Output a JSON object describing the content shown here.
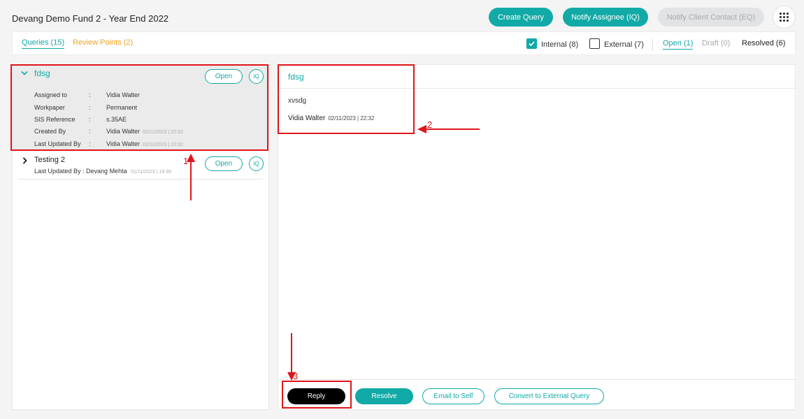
{
  "header": {
    "title": "Devang Demo Fund 2 - Year End 2022",
    "create_query": "Create Query",
    "notify_assignee": "Notify Assignee (IQ)",
    "notify_client": "Notify Client Contact (EQ)",
    "menu_icon": "grid-icon"
  },
  "tabs": {
    "queries": "Queries (15)",
    "review_points": "Review Points (2)",
    "internal": "Internal (8)",
    "external": "External (7)",
    "open": "Open (1)",
    "draft": "Draft (0)",
    "resolved": "Resolved (6)",
    "internal_checked": true,
    "external_checked": false
  },
  "query_list": [
    {
      "title": "fdsg",
      "status": "Open",
      "type": "IQ",
      "expanded": true,
      "details": [
        {
          "label": "Assigned to",
          "value": "Vidia Walter",
          "ts": ""
        },
        {
          "label": "Workpaper",
          "value": "Permanent",
          "ts": ""
        },
        {
          "label": "SIS Reference",
          "value": "s.35AE",
          "ts": ""
        },
        {
          "label": "Created By",
          "value": "Vidia Walter",
          "ts": "02/11/2023 | 22:32"
        },
        {
          "label": "Last Updated By",
          "value": "Vidia Walter",
          "ts": "02/11/2023 | 22:32"
        }
      ]
    },
    {
      "title": "Testing 2",
      "status": "Open",
      "type": "IQ",
      "expanded": false,
      "updated_prefix": "Last Updated By : Devang Mehta",
      "updated_ts": "01/11/2023 | 19:39"
    }
  ],
  "detail": {
    "title": "fdsg",
    "body": "xvsdg",
    "author": "Vidia Walter",
    "ts": "02/11/2023 | 22:32"
  },
  "footer": {
    "reply": "Reply",
    "resolve": "Resolve",
    "email_self": "Email to Self",
    "convert": "Convert to External Query"
  },
  "annotations": [
    "1",
    "2",
    "3"
  ],
  "colors": {
    "accent": "#11aaa6",
    "review": "#f0a31c",
    "annotation": "#e0151b"
  }
}
